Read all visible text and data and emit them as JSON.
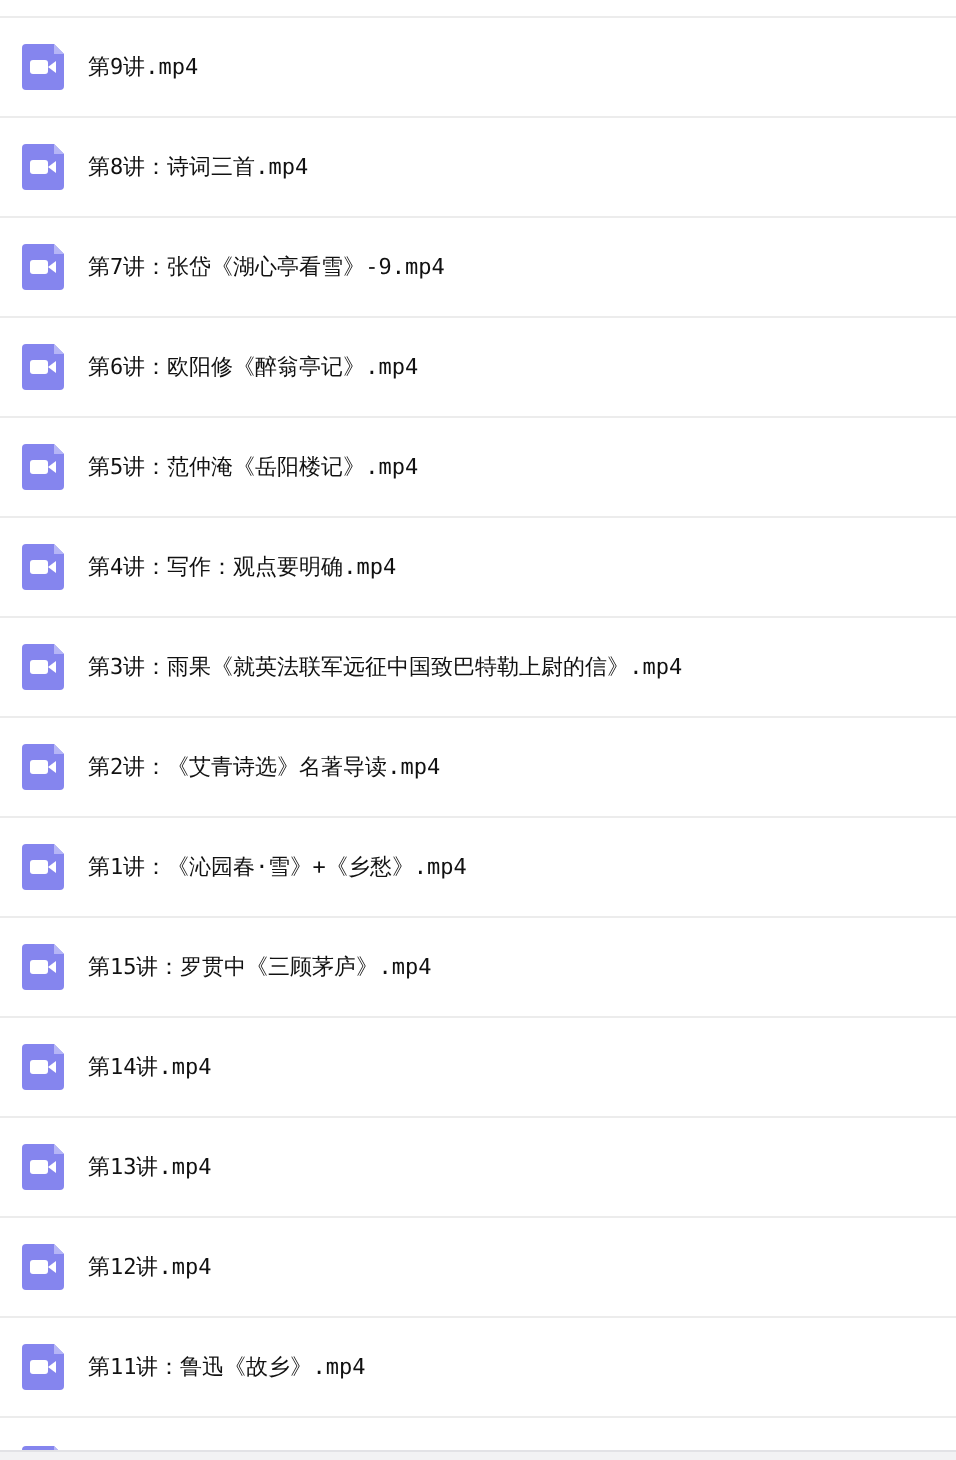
{
  "files": [
    {
      "name": "第9讲.mp4"
    },
    {
      "name": "第8讲：诗词三首.mp4"
    },
    {
      "name": "第7讲：张岱《湖心亭看雪》-9.mp4"
    },
    {
      "name": "第6讲：欧阳修《醉翁亭记》.mp4"
    },
    {
      "name": "第5讲：范仲淹《岳阳楼记》.mp4"
    },
    {
      "name": "第4讲：写作：观点要明确.mp4"
    },
    {
      "name": "第3讲：雨果《就英法联军远征中国致巴特勒上尉的信》.mp4"
    },
    {
      "name": "第2讲：《艾青诗选》名著导读.mp4"
    },
    {
      "name": "第1讲：《沁园春·雪》+《乡愁》.mp4"
    },
    {
      "name": "第15讲：罗贯中《三顾茅庐》.mp4"
    },
    {
      "name": "第14讲.mp4"
    },
    {
      "name": "第13讲.mp4"
    },
    {
      "name": "第12讲.mp4"
    },
    {
      "name": "第11讲：鲁迅《故乡》.mp4"
    }
  ]
}
